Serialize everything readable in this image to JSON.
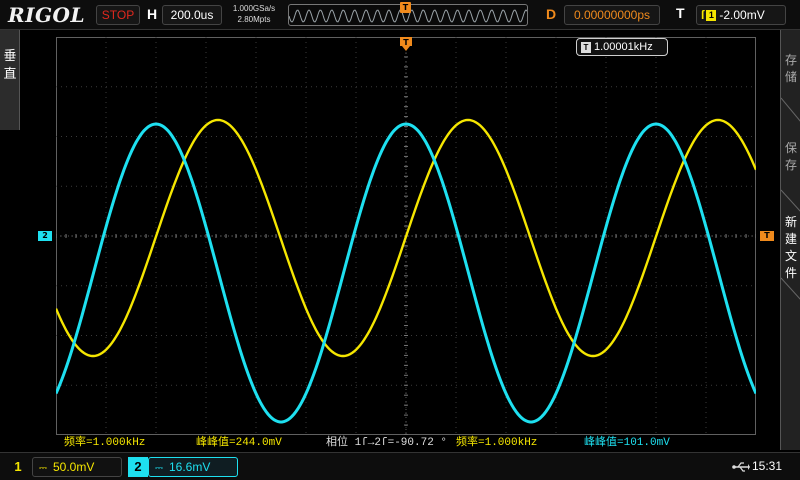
{
  "brand": "RIGOL",
  "top": {
    "run_state": "STOP",
    "horizontal_label": "H",
    "timebase": "200.0us",
    "sample_rate": "1.000GSa/s",
    "memory_depth": "2.80Mpts",
    "delay_label": "D",
    "delay_value": "0.00000000ps",
    "trigger_label": "T",
    "trigger_edge": "ſ",
    "trigger_source": "1",
    "trigger_level": "-2.00mV"
  },
  "left_menu": {
    "label": "垂直"
  },
  "right_menu": [
    {
      "label": "存储"
    },
    {
      "label": "保存"
    },
    {
      "label": "新建文件"
    }
  ],
  "screen": {
    "freq_badge_chip": "T",
    "freq_badge_value": "1.00001kHz",
    "ch2_marker": "2",
    "trigger_marker": "T"
  },
  "measurements": [
    {
      "text": "频率=1.000kHz",
      "color": "yellow"
    },
    {
      "text": "峰峰值=244.0mV",
      "color": "yellow"
    },
    {
      "text": "相位 1ſ→2ſ=-90.72 °",
      "color": "white"
    },
    {
      "text": "频率=1.000kHz",
      "color": "yellow"
    },
    {
      "text": "峰峰值=101.0mV",
      "color": "cyan"
    }
  ],
  "channels": [
    {
      "number": "1",
      "coupling": "⎓",
      "scale": "50.0mV",
      "color": "#f5e600"
    },
    {
      "number": "2",
      "coupling": "⎓",
      "scale": "16.6mV",
      "color": "#1ee0f0"
    }
  ],
  "status": {
    "usb_icon": "usb-icon",
    "time": "15:31"
  },
  "colors": {
    "ch1": "#f5e600",
    "ch2": "#1ee0f0",
    "trigger": "#f08a1c",
    "stop": "#e0281e"
  }
}
